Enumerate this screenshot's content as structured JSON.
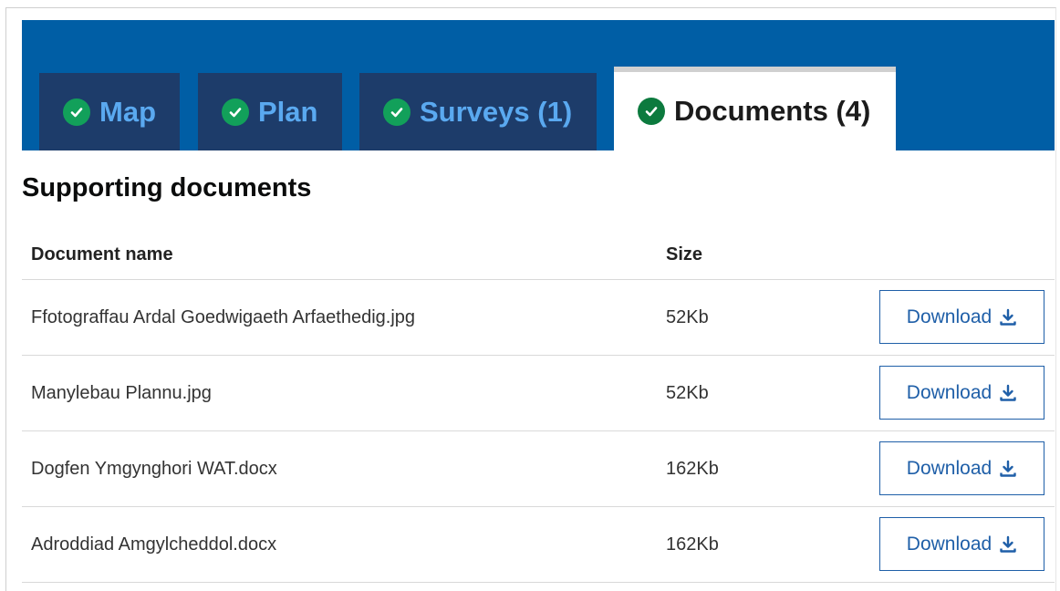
{
  "tabs": [
    {
      "label": "Map",
      "status": "complete",
      "active": false
    },
    {
      "label": "Plan",
      "status": "complete",
      "active": false
    },
    {
      "label": "Surveys (1)",
      "status": "complete",
      "active": false
    },
    {
      "label": "Documents (4)",
      "status": "complete",
      "active": true
    }
  ],
  "section": {
    "title": "Supporting documents"
  },
  "table": {
    "headers": {
      "name": "Document name",
      "size": "Size"
    },
    "rows": [
      {
        "name": "Ffotograffau Ardal Goedwigaeth Arfaethedig.jpg",
        "size": "52Kb",
        "action": "Download"
      },
      {
        "name": "Manylebau Plannu.jpg",
        "size": "52Kb",
        "action": "Download"
      },
      {
        "name": "Dogfen Ymgynghori WAT.docx",
        "size": "162Kb",
        "action": "Download"
      },
      {
        "name": "Adroddiad Amgylcheddol.docx",
        "size": "162Kb",
        "action": "Download"
      }
    ]
  },
  "icons": {
    "tab_status": "check-circle-icon",
    "download": "download-icon"
  },
  "colors": {
    "banner": "#005ea5",
    "tab_inactive_bg": "#1d3c6a",
    "tab_inactive_text": "#5aa9f0",
    "check_green": "#12a05a",
    "link_blue": "#1f5fa8"
  }
}
